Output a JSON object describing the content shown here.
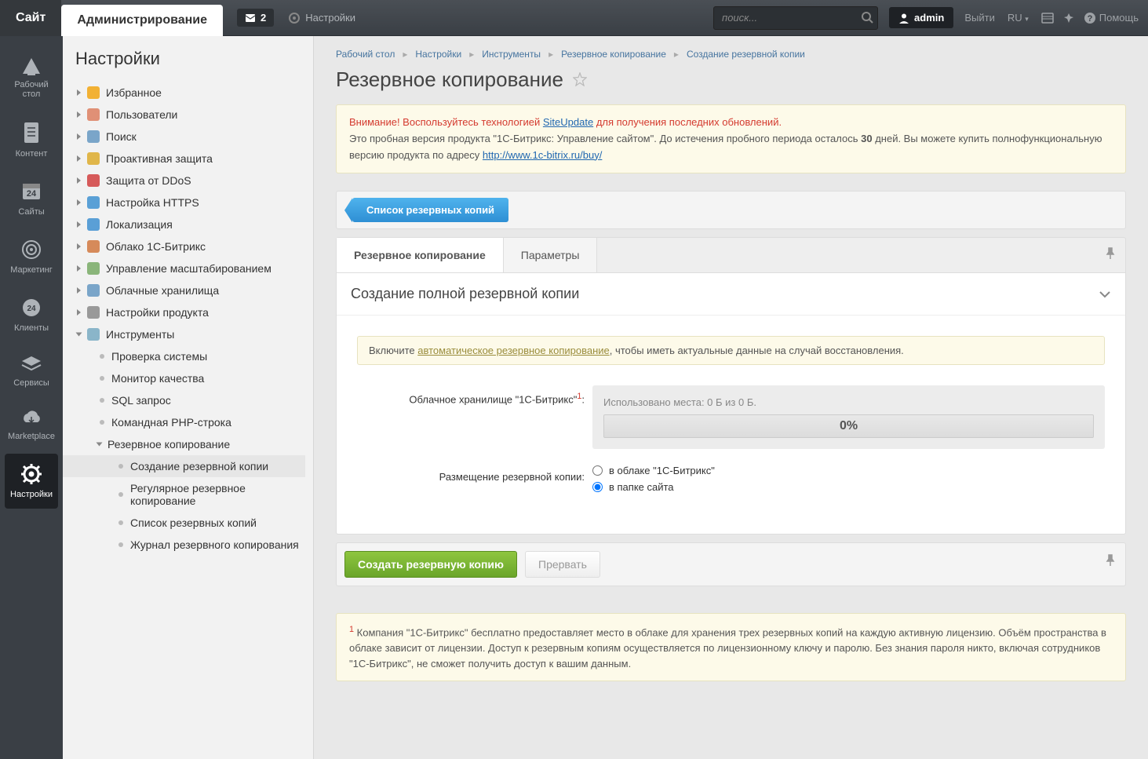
{
  "topbar": {
    "site_tab": "Сайт",
    "admin_tab": "Администрирование",
    "notif_count": "2",
    "settings_label": "Настройки",
    "search_placeholder": "поиск...",
    "user": "admin",
    "logout": "Выйти",
    "lang": "RU",
    "help": "Помощь"
  },
  "leftbar": [
    {
      "label": "Рабочий стол"
    },
    {
      "label": "Контент"
    },
    {
      "label": "Сайты"
    },
    {
      "label": "Маркетинг"
    },
    {
      "label": "Клиенты"
    },
    {
      "label": "Сервисы"
    },
    {
      "label": "Marketplace"
    },
    {
      "label": "Настройки"
    }
  ],
  "tree": {
    "title": "Настройки",
    "items": [
      {
        "label": "Избранное",
        "icon": "#f2b134"
      },
      {
        "label": "Пользователи",
        "icon": "#e09076"
      },
      {
        "label": "Поиск",
        "icon": "#7aa5c9"
      },
      {
        "label": "Проактивная защита",
        "icon": "#e0b64a"
      },
      {
        "label": "Защита от DDoS",
        "icon": "#d65a5a"
      },
      {
        "label": "Настройка HTTPS",
        "icon": "#5aa0d6"
      },
      {
        "label": "Локализация",
        "icon": "#5a9fd6"
      },
      {
        "label": "Облако 1С-Битрикс",
        "icon": "#d68a5a"
      },
      {
        "label": "Управление масштабированием",
        "icon": "#8ab57a"
      },
      {
        "label": "Облачные хранилища",
        "icon": "#7aa5c9"
      },
      {
        "label": "Настройки продукта",
        "icon": "#999"
      },
      {
        "label": "Инструменты",
        "icon": "#8ab5c9",
        "expanded": true,
        "children": [
          {
            "label": "Проверка системы"
          },
          {
            "label": "Монитор качества"
          },
          {
            "label": "SQL запрос"
          },
          {
            "label": "Командная PHP-строка"
          },
          {
            "label": "Резервное копирование",
            "expanded": true,
            "children": [
              {
                "label": "Создание резервной копии",
                "active": true
              },
              {
                "label": "Регулярное резервное копирование"
              },
              {
                "label": "Список резервных копий"
              },
              {
                "label": "Журнал резервного копирования"
              }
            ]
          }
        ]
      }
    ]
  },
  "breadcrumb": [
    "Рабочий стол",
    "Настройки",
    "Инструменты",
    "Резервное копирование",
    "Создание резервной копии"
  ],
  "page_title": "Резервное копирование",
  "alert": {
    "warn": "Внимание! Воспользуйтесь технологией ",
    "link1": "SiteUpdate",
    "tail1": " для получения последних обновлений.",
    "trial1": "Это пробная версия продукта \"1С-Битрикс: Управление сайтом\". До истечения пробного периода осталось ",
    "days": "30",
    "trial2": " дней. Вы можете купить полнофункциональную версию продукта по адресу ",
    "link2": "http://www.1c-bitrix.ru/buy/"
  },
  "toolbar": {
    "backup_list": "Список резервных копий"
  },
  "tabs": {
    "t1": "Резервное копирование",
    "t2": "Параметры"
  },
  "panel": {
    "heading": "Создание полной резервной копии",
    "hint_pre": "Включите ",
    "hint_link": "автоматическое резервное копирование",
    "hint_post": ", чтобы иметь актуальные данные на случай восстановления.",
    "storage_label": "Облачное хранилище \"1С-Битрикс\"",
    "storage_used": "Использовано места: 0 Б из 0 Б.",
    "storage_pct": "0%",
    "location_label": "Размещение резервной копии:",
    "radio1": "в облаке \"1С-Битрикс\"",
    "radio2": "в папке сайта"
  },
  "actions": {
    "create": "Создать резервную копию",
    "cancel": "Прервать"
  },
  "footnote": {
    "num": "1",
    "text": " Компания \"1С-Битрикс\" бесплатно предоставляет место в облаке для хранения трех резервных копий на каждую активную лицензию. Объём пространства в облаке зависит от лицензии. Доступ к резервным копиям осуществляется по лицензионному ключу и паролю. Без знания пароля никто, включая сотрудников \"1С-Битрикс\", не сможет получить доступ к вашим данным."
  }
}
